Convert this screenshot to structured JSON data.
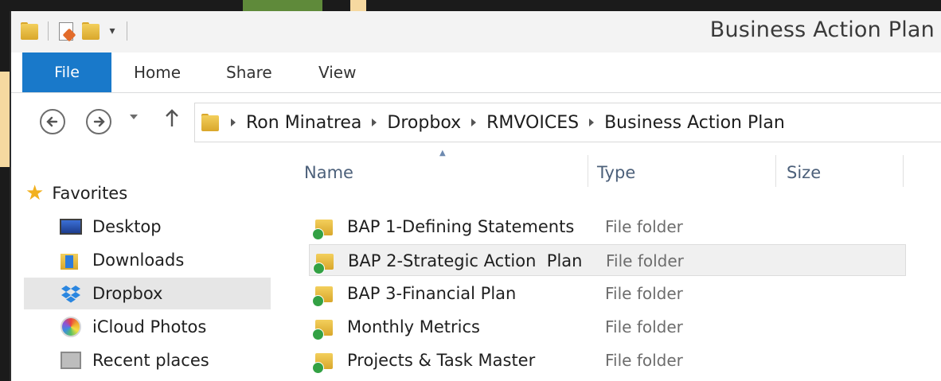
{
  "window": {
    "title": "Business Action Plan"
  },
  "quick_access_toolbar": {
    "dropdown_glyph": "▾"
  },
  "ribbon": {
    "tabs": [
      {
        "label": "File",
        "active": true
      },
      {
        "label": "Home"
      },
      {
        "label": "Share"
      },
      {
        "label": "View"
      }
    ]
  },
  "address_bar": {
    "breadcrumbs": [
      "Ron Minatrea",
      "Dropbox",
      "RMVOICES",
      "Business Action Plan"
    ]
  },
  "nav_pane": {
    "items": [
      {
        "label": "Favorites",
        "icon": "star-icon"
      },
      {
        "label": "Desktop",
        "icon": "desktop-icon"
      },
      {
        "label": "Downloads",
        "icon": "downloads-icon"
      },
      {
        "label": "Dropbox",
        "icon": "dropbox-icon",
        "selected": true
      },
      {
        "label": "iCloud Photos",
        "icon": "icloud-photos-icon"
      },
      {
        "label": "Recent places",
        "icon": "recent-places-icon"
      }
    ]
  },
  "file_list": {
    "columns": [
      "Name",
      "Type",
      "Size"
    ],
    "rows": [
      {
        "name": "BAP 1-Defining Statements",
        "type": "File folder"
      },
      {
        "name": "BAP 2-Strategic Action  Plan",
        "type": "File folder",
        "selected": true
      },
      {
        "name": "BAP 3-Financial Plan",
        "type": "File folder"
      },
      {
        "name": "Monthly Metrics",
        "type": "File folder"
      },
      {
        "name": "Projects & Task Master",
        "type": "File folder"
      }
    ]
  },
  "colors": {
    "file_tab": "#1979ca",
    "column_header_text": "#4c607a",
    "selected_row": "#f0f0f0",
    "sync_check": "#33a144",
    "folder": "#e6bb3f"
  }
}
